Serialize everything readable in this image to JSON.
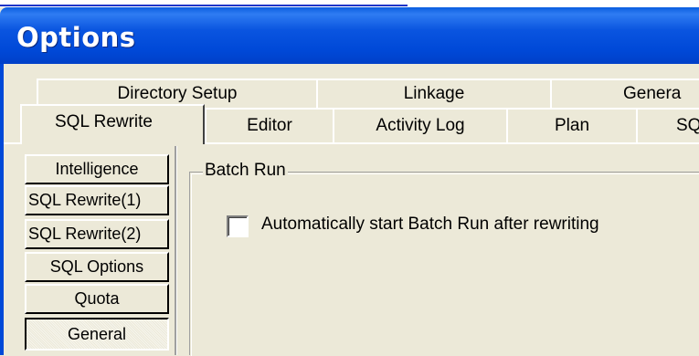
{
  "window": {
    "title": "Options"
  },
  "tabs_back_row": [
    {
      "label": "Directory Setup"
    },
    {
      "label": "Linkage"
    },
    {
      "label": "Genera"
    }
  ],
  "tabs_front_row": [
    {
      "label": "SQL Rewrite",
      "active": true
    },
    {
      "label": "Editor"
    },
    {
      "label": "Activity Log"
    },
    {
      "label": "Plan"
    },
    {
      "label": "SQ"
    }
  ],
  "sidebar": {
    "items": [
      {
        "label": "Intelligence"
      },
      {
        "label": "SQL Rewrite(1)"
      },
      {
        "label": "SQL Rewrite(2)"
      },
      {
        "label": "SQL Options"
      },
      {
        "label": "Quota"
      },
      {
        "label": "General",
        "selected": true
      }
    ]
  },
  "batch_run": {
    "group_label": "Batch Run",
    "checkbox_label": "Automatically start Batch Run after rewriting",
    "checked": false
  },
  "colors": {
    "title_bar": "#0049d8",
    "face": "#ece9d8",
    "link": "#1a34c8"
  }
}
